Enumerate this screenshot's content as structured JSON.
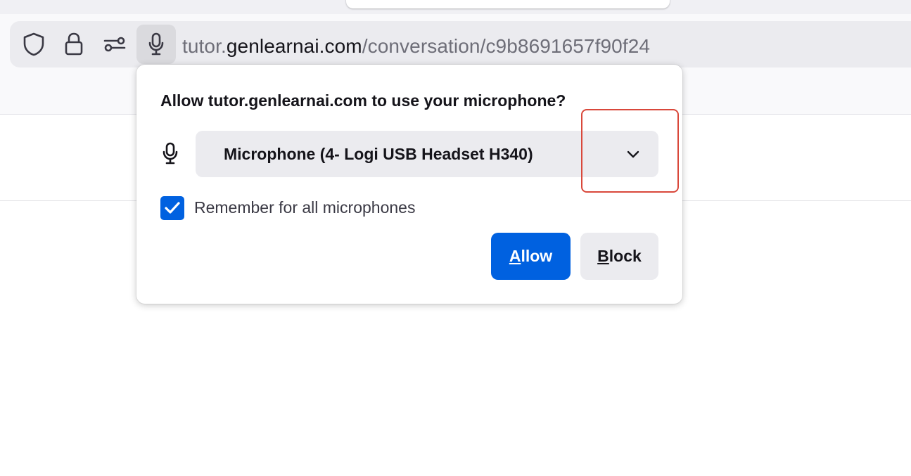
{
  "url": {
    "prefix": "tutor.",
    "domain": "genlearnai.com",
    "path": "/conversation/c9b8691657f90f24"
  },
  "urlbar_icons": [
    "shield-icon",
    "lock-icon",
    "permissions-icon",
    "microphone-icon"
  ],
  "panel": {
    "title": "Allow tutor.genlearnai.com to use your microphone?",
    "device_selected": "Microphone (4- Logi USB Headset H340)",
    "remember_label": "Remember for all microphones",
    "remember_checked": true,
    "allow": {
      "accesskey": "A",
      "rest": "llow"
    },
    "block": {
      "accesskey": "B",
      "rest": "lock"
    }
  },
  "colors": {
    "accent": "#0061e0",
    "highlight": "#d9483b"
  }
}
